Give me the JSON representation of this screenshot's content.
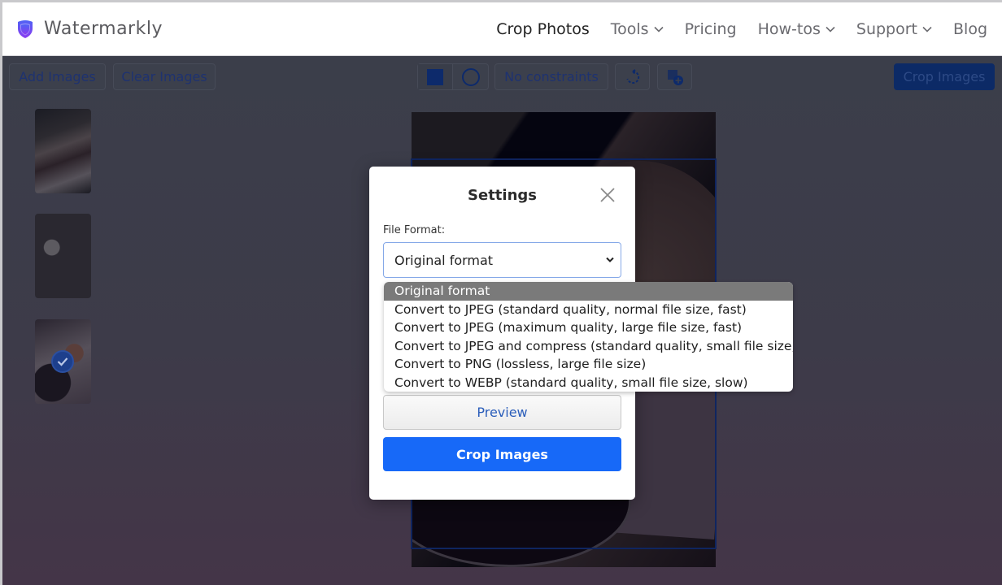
{
  "header": {
    "brand": "Watermarkly",
    "nav": [
      {
        "label": "Crop Photos",
        "active": true,
        "has_dropdown": false
      },
      {
        "label": "Tools",
        "active": false,
        "has_dropdown": true
      },
      {
        "label": "Pricing",
        "active": false,
        "has_dropdown": false
      },
      {
        "label": "How-tos",
        "active": false,
        "has_dropdown": true
      },
      {
        "label": "Support",
        "active": false,
        "has_dropdown": true
      },
      {
        "label": "Blog",
        "active": false,
        "has_dropdown": false
      }
    ]
  },
  "toolbar": {
    "add_images": "Add Images",
    "clear_images": "Clear Images",
    "shape_icons": [
      "rectangle-icon",
      "circle-icon"
    ],
    "constraints": "No constraints",
    "rotate_icon": "rotate-icon",
    "add_crop_icon": "add-crop-icon",
    "crop_images": "Crop Images"
  },
  "thumbnails": [
    {
      "selected": false
    },
    {
      "selected": false
    },
    {
      "selected": true
    }
  ],
  "modal": {
    "title": "Settings",
    "file_format_label": "File Format:",
    "selected_format": "Original format",
    "preview_label": "Preview",
    "crop_label": "Crop Images",
    "options": [
      "Original format",
      "Convert to JPEG (standard quality, normal file size, fast)",
      "Convert to JPEG (maximum quality, large file size, fast)",
      "Convert to JPEG and compress (standard quality, small file size, slow)",
      "Convert to PNG (lossless, large file size)",
      "Convert to WEBP (standard quality, small file size, slow)"
    ]
  },
  "colors": {
    "primary": "#1769f8",
    "brand_shield": "#6c4cf0",
    "overlay": "#3b3e4a"
  }
}
